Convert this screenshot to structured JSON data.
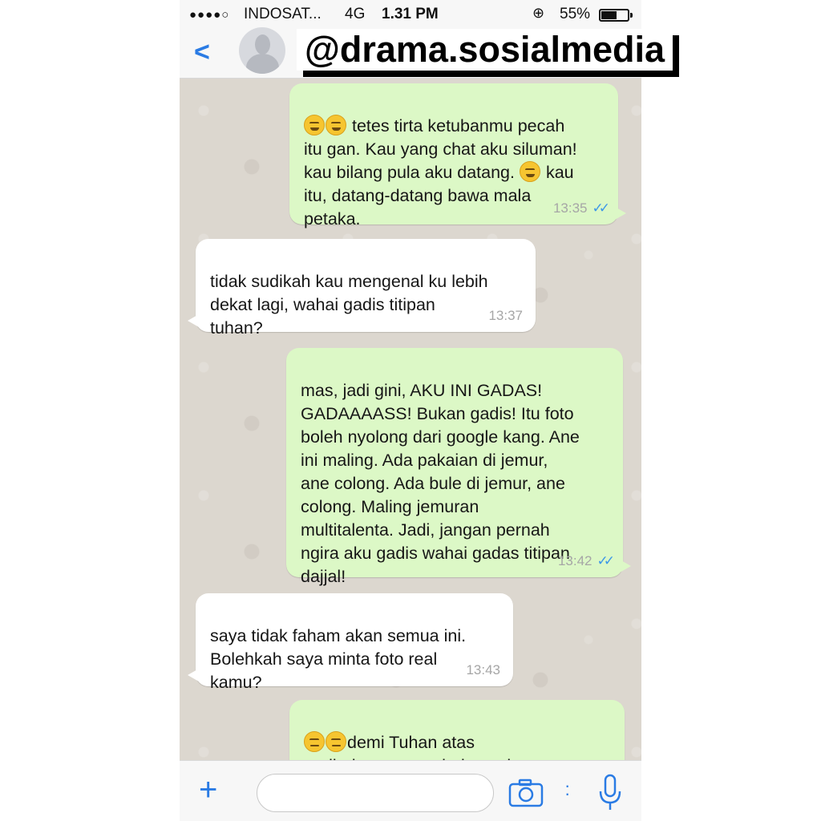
{
  "status_bar": {
    "signal": "●●●●○",
    "carrier": "INDOSAT...",
    "network": "4G",
    "time": "1.31 PM",
    "battery": "55%"
  },
  "watermark": "@drama.sosialmedia",
  "colors": {
    "accent": "#2a7be4",
    "outgoing_bubble": "#dcf8c6",
    "incoming_bubble": "#ffffff",
    "read_ticks": "#3c97e8",
    "chat_background": "#dcd7cf"
  },
  "messages": [
    {
      "direction": "outgoing",
      "emoji_prefix": [
        "rofl-emoji",
        "rofl-emoji"
      ],
      "text_1": " tetes tirta ketubanmu pecah\nitu gan. Kau yang chat aku siluman!\nkau bilang pula aku datang. ",
      "text_2": " kau\nitu, datang-datang bawa mala\npetaka.",
      "time": "13:35",
      "status": "read"
    },
    {
      "direction": "incoming",
      "text": "tidak sudikah kau mengenal ku lebih\ndekat lagi, wahai gadis titipan\ntuhan?",
      "time": "13:37"
    },
    {
      "direction": "outgoing",
      "text": "mas, jadi gini, AKU INI GADAS!\nGADAAAASS! Bukan gadis! Itu foto\nboleh nyolong dari google kang. Ane\nini maling.  Ada pakaian di jemur,\nane colong. Ada bule di jemur, ane\ncolong.  Maling jemuran\nmultitalenta. Jadi, jangan pernah\nngira aku gadis wahai gadas titipan\ndajjal!",
      "time": "13:42",
      "status": "read"
    },
    {
      "direction": "incoming",
      "text": "saya tidak faham akan semua ini.\nBolehkah saya minta foto real\nkamu?",
      "time": "13:43"
    },
    {
      "direction": "outgoing",
      "emoji_prefix": [
        "expressionless-emoji",
        "expressionless-emoji"
      ],
      "text": "demi Tuhan atas\nperlindungannya dari segala mara-\nbahaya. Gan, situ ngerti bahasa",
      "status": "partially-visible"
    }
  ],
  "input_bar": {
    "message_value": "",
    "icons": [
      "plus-icon",
      "camera-icon",
      "more-dots-icon",
      "microphone-icon"
    ]
  },
  "nav": {
    "icons": [
      "back-chevron-icon",
      "contact-avatar"
    ]
  }
}
